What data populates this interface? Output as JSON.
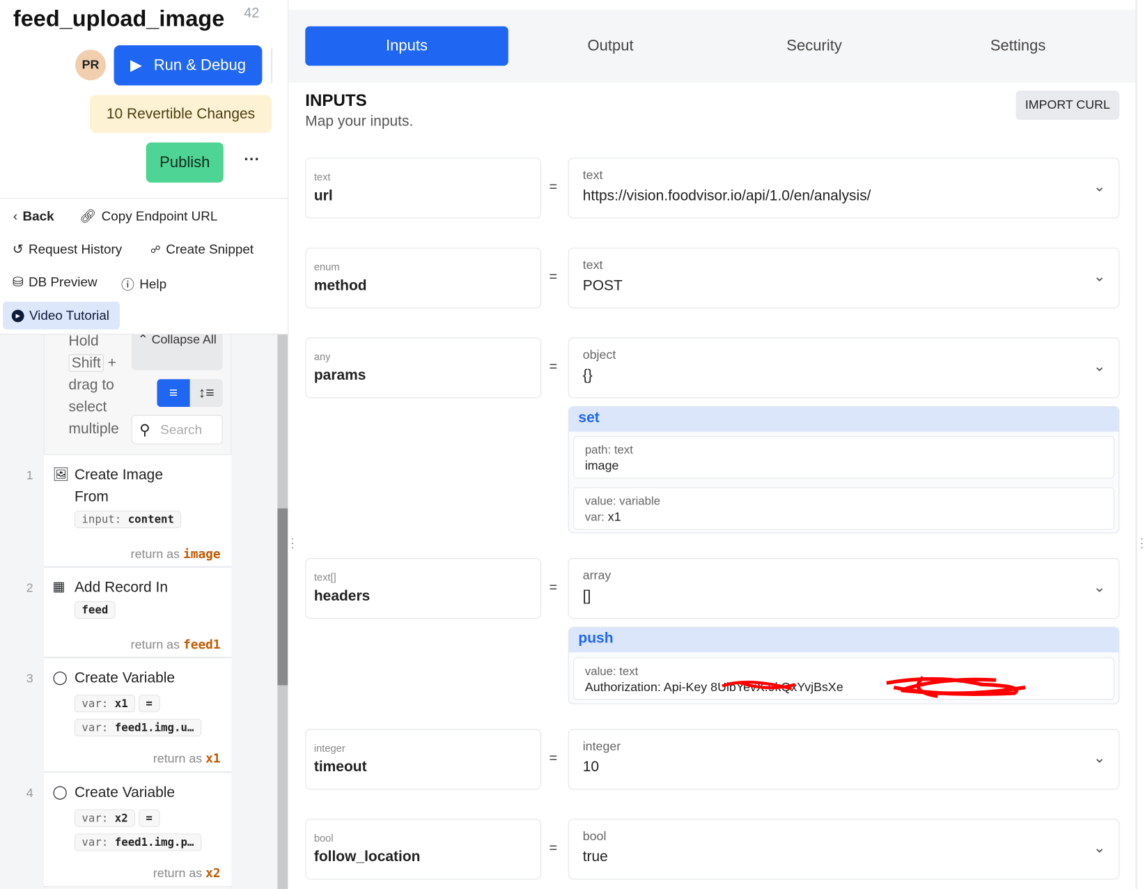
{
  "header": {
    "title": "feed_upload_image",
    "version": "42",
    "avatar": "PR",
    "run_label": "Run & Debug",
    "revertible": "10 Revertible Changes",
    "publish_label": "Publish",
    "more": "···"
  },
  "nav": {
    "back": "Back",
    "copy_endpoint": "Copy Endpoint URL",
    "request_history": "Request History",
    "create_snippet": "Create Snippet",
    "db_preview": "DB Preview",
    "help": "Help",
    "video_tutorial": "Video Tutorial"
  },
  "stack": {
    "hint_hold": "Hold",
    "hint_shift": "Shift",
    "hint_plus": "+",
    "hint_rest": "drag to select multiple",
    "collapse_all": "Collapse All",
    "search_placeholder": "Search",
    "steps": [
      {
        "num": "1",
        "title": "Create Image From",
        "chip1_key": "input:",
        "chip1_val": "content",
        "return_label": "return as",
        "return_var": "image"
      },
      {
        "num": "2",
        "title": "Add Record In",
        "chip1_val": "feed",
        "return_label": "return as",
        "return_var": "feed1"
      },
      {
        "num": "3",
        "title": "Create Variable",
        "chip1_key": "var:",
        "chip1_val": "x1",
        "eq": "=",
        "chip2_key": "var:",
        "chip2_val": "feed1.img.u…",
        "return_label": "return as",
        "return_var": "x1"
      },
      {
        "num": "4",
        "title": "Create Variable",
        "chip1_key": "var:",
        "chip1_val": "x2",
        "eq": "=",
        "chip2_key": "var:",
        "chip2_val": "feed1.img.p…",
        "return_label": "return as",
        "return_var": "x2"
      }
    ]
  },
  "tabs": [
    "Inputs",
    "Output",
    "Security",
    "Settings"
  ],
  "main": {
    "heading": "INPUTS",
    "subheading": "Map your inputs.",
    "import_curl": "IMPORT CURL",
    "inputs": [
      {
        "type": "text",
        "name": "url",
        "value_type": "text",
        "value": "https://vision.foodvisor.io/api/1.0/en/analysis/"
      },
      {
        "type": "enum",
        "name": "method",
        "value_type": "text",
        "value": "POST"
      },
      {
        "type": "any",
        "name": "params",
        "value_type": "object",
        "value": "{}"
      },
      {
        "type": "text[]",
        "name": "headers",
        "value_type": "array",
        "value": "[]"
      },
      {
        "type": "integer",
        "name": "timeout",
        "value_type": "integer",
        "value": "10"
      },
      {
        "type": "bool",
        "name": "follow_location",
        "value_type": "bool",
        "value": "true"
      }
    ],
    "eq": "=",
    "params_op": {
      "label": "set",
      "path_key": "path: text",
      "path_val": "image",
      "value_key": "value: variable",
      "value_prefix": "var:",
      "value_val": "x1"
    },
    "headers_op": {
      "label": "push",
      "value_key": "value: text",
      "value_val": "Authorization: Api-Key 8UlbYevX.9kQxYvjBsXe"
    }
  },
  "colors": {
    "primary": "#1f66f2",
    "publish": "#4ed494",
    "revert_bg": "#fdf3d4",
    "return_var": "#c25a00"
  }
}
